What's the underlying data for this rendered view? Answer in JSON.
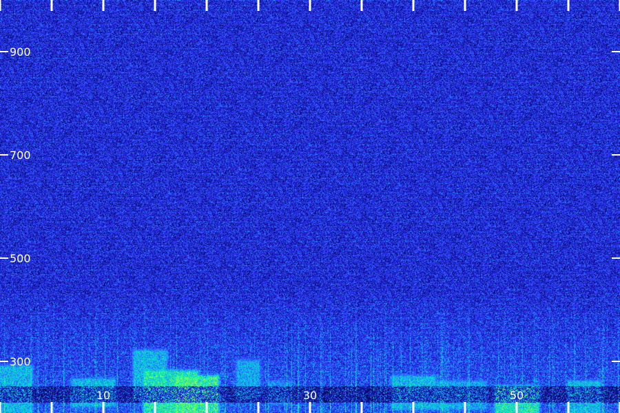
{
  "chart_data": {
    "type": "heatmap",
    "title": "",
    "xlabel": "",
    "ylabel": "",
    "xlim": [
      0,
      60
    ],
    "ylim": [
      200,
      1000
    ],
    "x_tick_values": [
      0,
      5,
      10,
      15,
      20,
      25,
      30,
      35,
      40,
      45,
      50,
      55,
      60
    ],
    "x_tick_labels": [
      {
        "value": 10,
        "label": "10"
      },
      {
        "value": 30,
        "label": "30"
      },
      {
        "value": 50,
        "label": "50"
      }
    ],
    "y_tick_values": [
      300,
      500,
      700,
      900
    ],
    "y_tick_labels": [
      {
        "value": 300,
        "label": "300"
      },
      {
        "value": 500,
        "label": "500"
      },
      {
        "value": 700,
        "label": "700"
      },
      {
        "value": 900,
        "label": "900"
      }
    ],
    "colormap": [
      "#000000",
      "#0a0a6e",
      "#1e22d8",
      "#3a3aff",
      "#1aa0ff",
      "#00e0d0",
      "#30ff80",
      "#d8ff20"
    ],
    "background_level": 0.32,
    "energy_regions": [
      {
        "x": [
          0,
          3
        ],
        "y": [
          200,
          290
        ],
        "level": 0.8
      },
      {
        "x": [
          7,
          11
        ],
        "y": [
          215,
          265
        ],
        "level": 0.8
      },
      {
        "x": [
          13,
          16
        ],
        "y": [
          230,
          320
        ],
        "level": 0.8
      },
      {
        "x": [
          14,
          19
        ],
        "y": [
          200,
          280
        ],
        "level": 0.95
      },
      {
        "x": [
          17,
          21
        ],
        "y": [
          200,
          270
        ],
        "level": 1.0
      },
      {
        "x": [
          23,
          25
        ],
        "y": [
          230,
          300
        ],
        "level": 0.75
      },
      {
        "x": [
          26,
          28
        ],
        "y": [
          220,
          260
        ],
        "level": 0.7
      },
      {
        "x": [
          38,
          42
        ],
        "y": [
          210,
          270
        ],
        "level": 0.8
      },
      {
        "x": [
          42,
          47
        ],
        "y": [
          210,
          260
        ],
        "level": 0.75
      },
      {
        "x": [
          48,
          52
        ],
        "y": [
          200,
          250
        ],
        "level": 0.95
      },
      {
        "x": [
          55,
          58
        ],
        "y": [
          200,
          260
        ],
        "level": 0.8
      }
    ]
  }
}
